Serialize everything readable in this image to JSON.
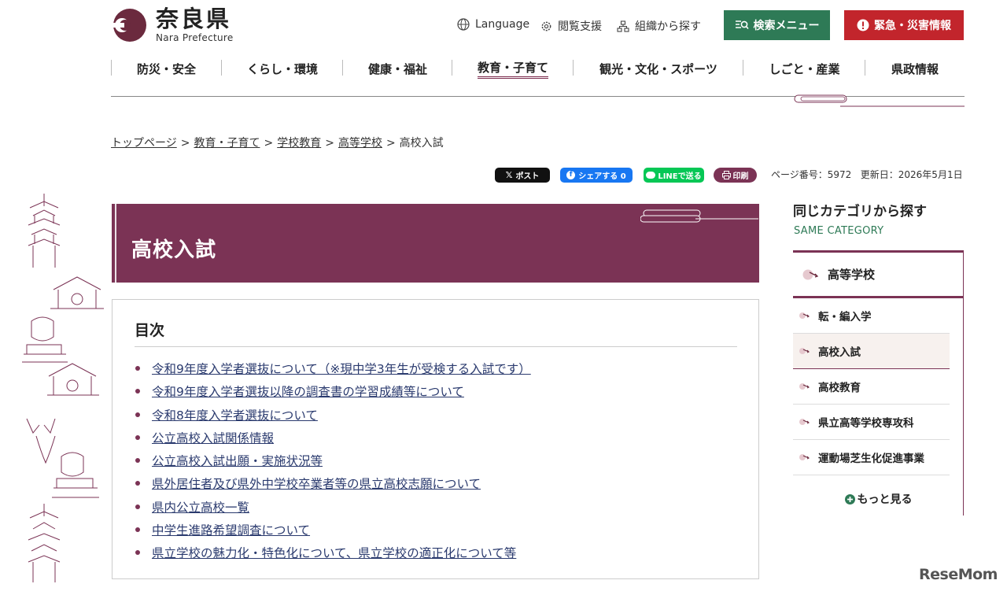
{
  "header": {
    "logo_jp": "奈良県",
    "logo_en": "Nara Prefecture",
    "language": "Language",
    "accessibility": "閲覧支援",
    "org_search": "組織から探す",
    "search_menu": "検索メニュー",
    "emergency": "緊急・災害情報"
  },
  "nav": [
    "防災・安全",
    "くらし・環境",
    "健康・福祉",
    "教育・子育て",
    "観光・文化・スポーツ",
    "しごと・産業",
    "県政情報"
  ],
  "breadcrumb": {
    "items": [
      "トップページ",
      "教育・子育て",
      "学校教育",
      "高等学校"
    ],
    "current": "高校入試",
    "separator": ">"
  },
  "share": {
    "x_post": "ポスト",
    "fb_share": "シェアする 0",
    "line": "LINEで送る",
    "print": "印刷",
    "page_number": "ページ番号：5972",
    "updated": "更新日：2026年5月1日"
  },
  "page_title": "高校入試",
  "toc": {
    "heading": "目次",
    "items": [
      "令和9年度入学者選抜について（※現中学3年生が受検する入試です）",
      "令和9年度入学者選抜以降の調査書の学習成績等について",
      "令和8年度入学者選抜について",
      "公立高校入試関係情報",
      "公立高校入試出願・実施状況等",
      "県外居住者及び県外中学校卒業者等の県立高校志願について",
      "県内公立高校一覧",
      "中学生進路希望調査について",
      "県立学校の魅力化・特色化について、県立学校の適正化について等"
    ]
  },
  "sidebar": {
    "heading": "同じカテゴリから探す",
    "subheading": "SAME CATEGORY",
    "parent": "高等学校",
    "items": [
      "転・編入学",
      "高校入試",
      "高校教育",
      "県立高等学校専攻科",
      "運動場芝生化促進事業"
    ],
    "more": "もっと見る"
  },
  "watermark": "ReseMom",
  "colors": {
    "accent": "#7b3355",
    "green": "#2e7a56",
    "red": "#c2252c"
  }
}
